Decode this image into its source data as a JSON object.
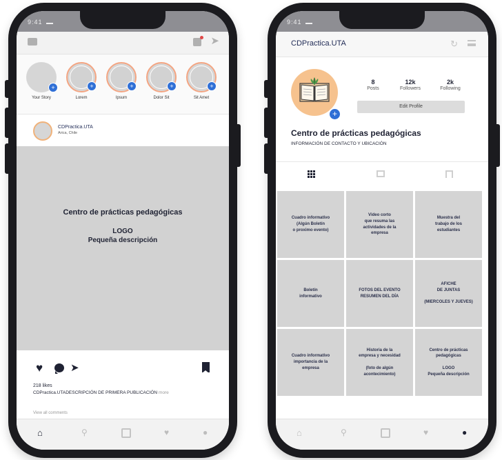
{
  "left_phone": {
    "stories": [
      {
        "label": "Your Story"
      },
      {
        "label": "Lorem"
      },
      {
        "label": "Ipsum"
      },
      {
        "label": "Dolor Sit"
      },
      {
        "label": "Sit Amet"
      }
    ],
    "post": {
      "username": "CDPractica.UTA",
      "location": "Arica, Chile",
      "image_title": "Centro de prácticas pedagógicas",
      "image_logo": "LOGO",
      "image_desc": "Pequeña descripción",
      "likes": "218 likes",
      "caption_user": "CDPractica.UTA",
      "caption_text": "DESCRIPCIÓN DE PRIMERA PUBLICACIÓN",
      "caption_more": "more",
      "comments_link": "View all comments"
    }
  },
  "right_phone": {
    "username": "CDPractica.UTA",
    "stats": {
      "posts_count": "8",
      "posts_label": "Posts",
      "followers_count": "12k",
      "followers_label": "Followers",
      "following_count": "2k",
      "following_label": "Following"
    },
    "edit_profile": "Edit Profile",
    "name": "Centro de prácticas pedagógicas",
    "bio": "INFORMACIÓN DE CONTACTO Y UBICACIÓN",
    "grid": [
      "Cuadro informativo\n(Algún Boletín\no proximo evento)",
      "Video corto\nque resuma las\nactividades de la\nempresa",
      "Muestra del\ntrabajo de los\nestudiantes",
      "Boletín\ninformativo",
      "FOTOS DEL EVENTO\nRESUMEN DEL DÍA",
      "AFICHE\nDE JUNTAS\n\n(MIERCOLES Y JUEVES)",
      "Cuadro informativo\nimportancia de la\nempresa",
      "Historia de la\nempresa y necesidad\n\n(foto de algún\nacontecimiento)",
      "Centro de prácticas\npedagógicas\n\nLOGO\nPequeña descripción"
    ]
  },
  "colors": {
    "phone_frame": "#1b1b1f",
    "placeholder_gray": "#d2d2d2",
    "story_ring": "#f4a582",
    "avatar_orange": "#f6c28e",
    "accent_blue": "#2f6fd6",
    "text_navy": "#1f2233"
  },
  "icons": {
    "left_header": [
      "camera-icon",
      "igtv-icon",
      "direct-message-icon"
    ],
    "post_actions": [
      "heart-icon",
      "comment-icon",
      "share-icon",
      "bookmark-icon"
    ],
    "bottom_nav": [
      "home-icon",
      "search-icon",
      "add-post-icon",
      "activity-heart-icon",
      "profile-icon"
    ],
    "profile_tabs": [
      "grid-icon",
      "igtv-icon",
      "tagged-icon"
    ],
    "right_header": [
      "history-icon",
      "menu-icon"
    ]
  }
}
